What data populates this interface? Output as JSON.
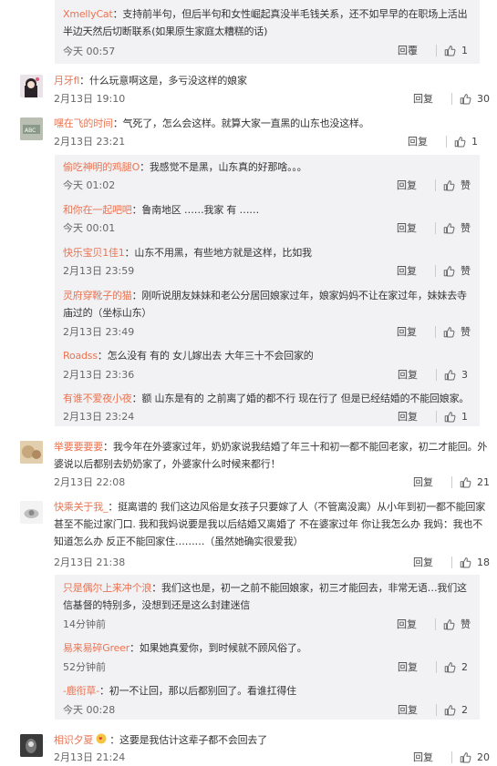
{
  "top_sub": {
    "user": "XmellyCat",
    "sep": "：",
    "text": "支持前半句，但后半句和女性崛起真没半毛钱关系，还不如早早的在职场上活出半边天然后切断联系(如果原生家庭太糟糕的话)",
    "time": "今天 00:57",
    "reply": "回覆",
    "likes": "1"
  },
  "c1": {
    "user": "月牙fl",
    "sep": "：",
    "text": "什么玩意啊这是，多亏没这样的娘家",
    "time": "2月13日 19:10",
    "reply": "回复",
    "likes": "30"
  },
  "c2": {
    "user": "嘿在飞的时间",
    "sep": "：",
    "text": "气死了，怎么会这样。就算大家一直黑的山东也没这样。",
    "time": "2月13日 23:21",
    "reply": "回复",
    "likes": "1"
  },
  "c2s1": {
    "user": "偷吃神明的鸡腿O",
    "sep": "：",
    "text": "我感觉不是黑，山东真的好那啥。。。",
    "time": "今天 01:02",
    "reply": "回复",
    "likes": "赞"
  },
  "c2s2": {
    "user": "和你在一起吧吧",
    "sep": "：",
    "text": "鲁南地区 ……我家 有 ……",
    "time": "今天 00:01",
    "reply": "回复",
    "likes": "赞"
  },
  "c2s3": {
    "user": "快乐宝贝1佳1",
    "sep": "：",
    "text": "山东不用黑，有些地方就是这样，比如我",
    "time": "2月13日 23:59",
    "reply": "回复",
    "likes": "赞"
  },
  "c2s4": {
    "user": "灵府穿靴子的猫",
    "sep": "：",
    "text": "刚听说朋友妹妹和老公分居回娘家过年，娘家妈妈不让在家过年，妹妹去寺庙过的（坐标山东）",
    "time": "2月13日 23:49",
    "reply": "回复",
    "likes": "赞"
  },
  "c2s5": {
    "user": "Roadss",
    "sep": "：",
    "text": "怎么没有 有的 女儿嫁出去 大年三十不会回家的",
    "time": "2月13日 23:36",
    "reply": "回复",
    "likes": "3"
  },
  "c2s6": {
    "user": "有谁不爱夜小夜",
    "sep": "：",
    "text": "额 山东是有的 之前离了婚的都不行 现在行了 但是已经结婚的不能回娘家。",
    "time": "2月13日 23:24",
    "reply": "回复",
    "likes": "1"
  },
  "c3": {
    "user": "举要要要要",
    "sep": "：",
    "text": "我今年在外婆家过年，奶奶家说我结婚了年三十和初一都不能回老家，初二才能回。外婆说以后都别去奶奶家了，外婆家什么时候来都行！",
    "time": "2月13日 22:08",
    "reply": "回复",
    "likes": "21"
  },
  "c4": {
    "user": "快乘关于我_",
    "sep": "：",
    "text": "挺离谱的 我们这边风俗是女孩子只要嫁了人（不管离没离）从小年到初一都不能回家 甚至不能过家门口. 我和我妈说要是我以后结婚又离婚了 不在婆家过年 你让我怎么办 我妈：我也不知道怎么办 反正不能回家住………（虽然她确实很爱我）",
    "time": "2月13日 21:38",
    "reply": "回复",
    "likes": "18"
  },
  "c4s1": {
    "user": "只是偶尔上来冲个浪",
    "sep": "：",
    "text": "我们这也是，初一之前不能回娘家，初三才能回去，非常无语…我们这信基督的特别多，没想到还是这么封建迷信",
    "time": "14分钟前",
    "reply": "回复",
    "likes": "赞"
  },
  "c4s2": {
    "user": "易来易碎Greer",
    "sep": "：",
    "text": "如果她真爱你，到时候就不顾风俗了。",
    "time": "52分钟前",
    "reply": "回复",
    "likes": "2"
  },
  "c4s3": {
    "user": "-鹿衔草-",
    "sep": "：",
    "text": "初一不让回，那以后都别回了。看谁扛得住",
    "time": "今天 00:28",
    "reply": "回复",
    "likes": "2"
  },
  "c5": {
    "user": "相识夕夏",
    "sep": "：",
    "text": "这要是我估计这辈子都不会回去了",
    "time": "2月13日 21:24",
    "reply": "回复",
    "likes": "20"
  },
  "colors": {
    "username": "#eb7350",
    "sub_bg": "#f2f2f5",
    "time": "#666666"
  },
  "icons": {
    "like": "thumbs-up-icon",
    "emoji": "heart-emoji-icon"
  }
}
